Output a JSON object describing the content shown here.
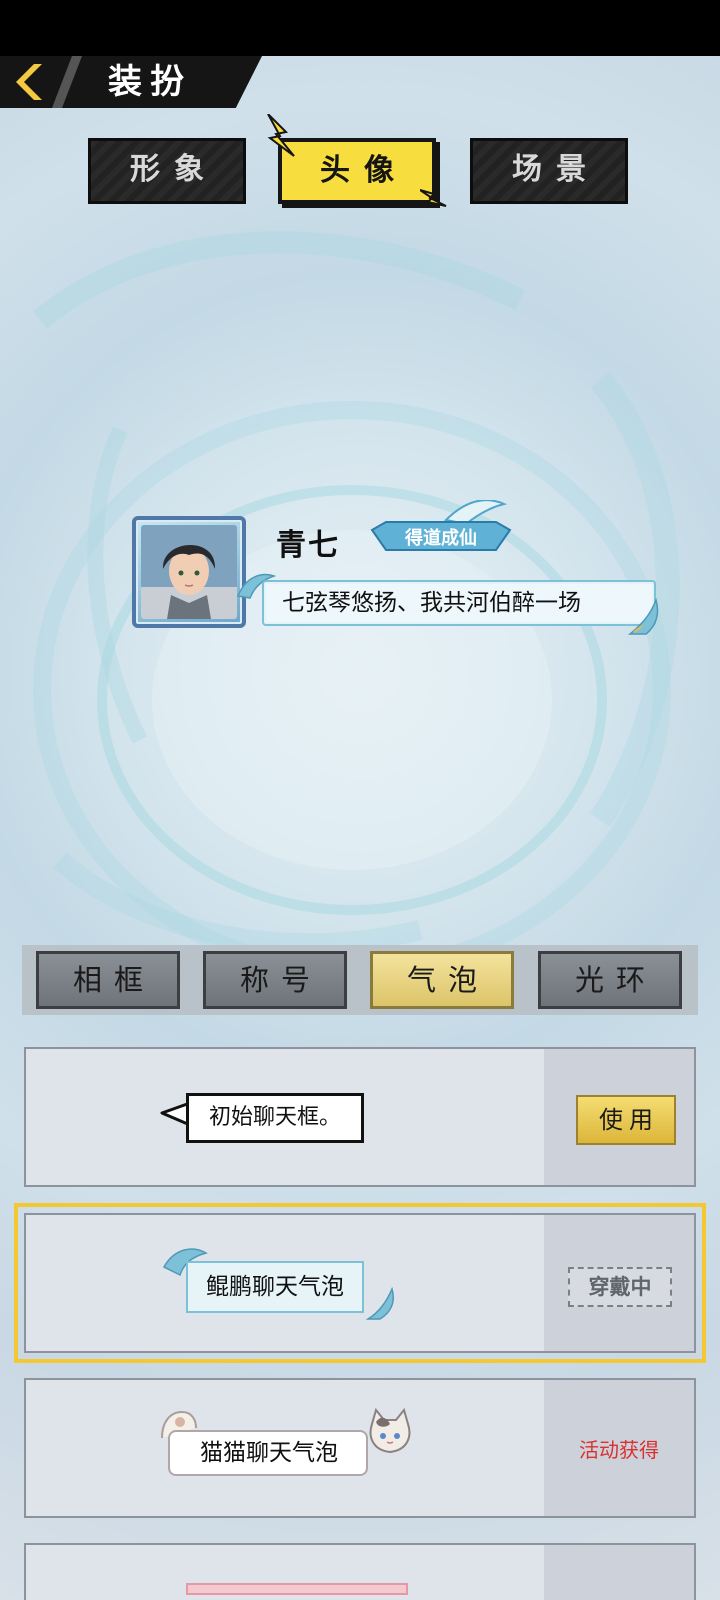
{
  "header": {
    "title": "装扮"
  },
  "top_tabs": [
    {
      "label": "形象",
      "active": false
    },
    {
      "label": "头像",
      "active": true
    },
    {
      "label": "场景",
      "active": false
    }
  ],
  "preview": {
    "name": "青七",
    "title_badge": "得道成仙",
    "bubble_text": "七弦琴悠扬、我共河伯醉一场"
  },
  "category_tabs": [
    {
      "label": "相框",
      "active": false
    },
    {
      "label": "称号",
      "active": false
    },
    {
      "label": "气泡",
      "active": true
    },
    {
      "label": "光环",
      "active": false
    }
  ],
  "bubbles": [
    {
      "name": "初始聊天框。",
      "action": "使用",
      "status": "available"
    },
    {
      "name": "鲲鹏聊天气泡",
      "action": "穿戴中",
      "status": "wearing"
    },
    {
      "name": "猫猫聊天气泡",
      "action": "活动获得",
      "status": "locked"
    }
  ],
  "colors": {
    "accent_yellow": "#f7dd3e",
    "selected_outline": "#f3c832",
    "event_red": "#d93030"
  }
}
